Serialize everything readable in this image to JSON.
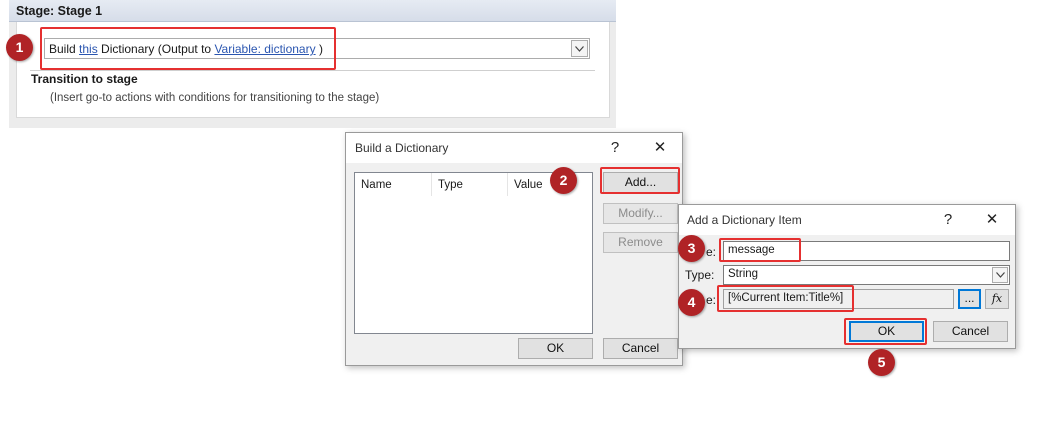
{
  "stage": {
    "title": "Stage: Stage 1",
    "action": {
      "prefix": "Build ",
      "link1": "this",
      "middle": " Dictionary (Output to ",
      "link2": "Variable: dictionary",
      "suffix": " )"
    },
    "transition_title": "Transition to stage",
    "transition_desc": "(Insert go-to actions with conditions for transitioning to the stage)"
  },
  "build_dialog": {
    "title": "Build a Dictionary",
    "help": "?",
    "close": "✕",
    "columns": [
      "Name",
      "Type",
      "Value"
    ],
    "buttons": {
      "add": "Add...",
      "modify": "Modify...",
      "remove": "Remove",
      "ok": "OK",
      "cancel": "Cancel"
    }
  },
  "item_dialog": {
    "title": "Add a Dictionary Item",
    "help": "?",
    "close": "✕",
    "name_label": "e:",
    "name_value": "message",
    "type_label": "Type:",
    "type_value": "String",
    "value_label": "e:",
    "value_value": "[%Current Item:Title%]",
    "browse": "...",
    "fx": "fx",
    "ok": "OK",
    "cancel": "Cancel"
  },
  "badges": [
    "1",
    "2",
    "3",
    "4",
    "5"
  ],
  "colors": {
    "highlight": "#e53030",
    "badge": "#b02326",
    "link": "#2b56b0"
  }
}
